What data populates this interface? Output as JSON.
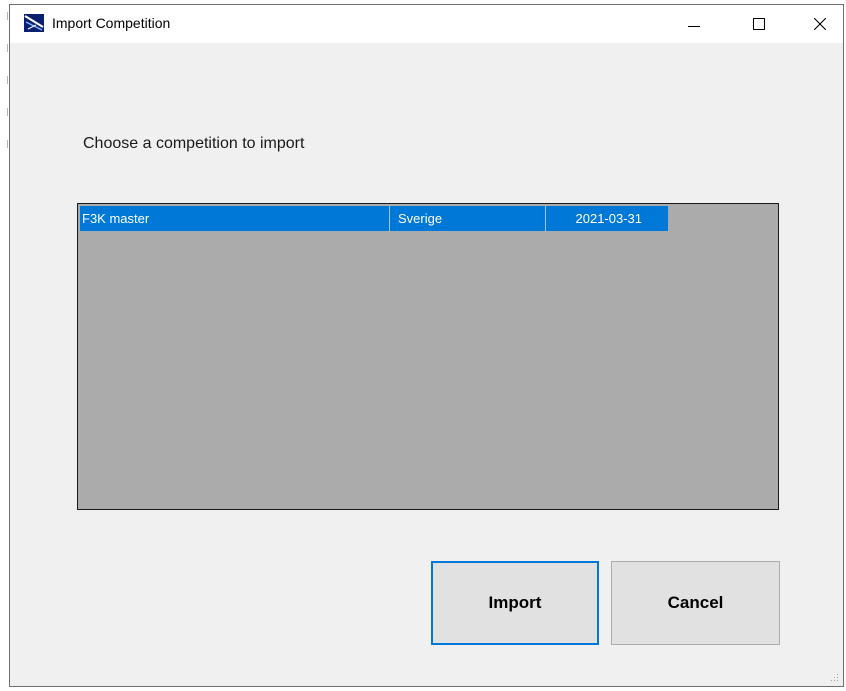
{
  "window": {
    "title": "Import Competition",
    "controls": {
      "minimize_icon": "minimize-icon",
      "maximize_icon": "maximize-icon",
      "close_icon": "close-icon"
    }
  },
  "main": {
    "prompt": "Choose a competition to import",
    "competitions": [
      {
        "name": "F3K master",
        "country": "Sverige",
        "date": "2021-03-31",
        "selected": true
      }
    ]
  },
  "buttons": {
    "import_label": "Import",
    "cancel_label": "Cancel"
  },
  "colors": {
    "selection": "#0078d7",
    "list_background": "#ababab",
    "window_background": "#f0f0f0",
    "button_face": "#e1e1e1"
  }
}
